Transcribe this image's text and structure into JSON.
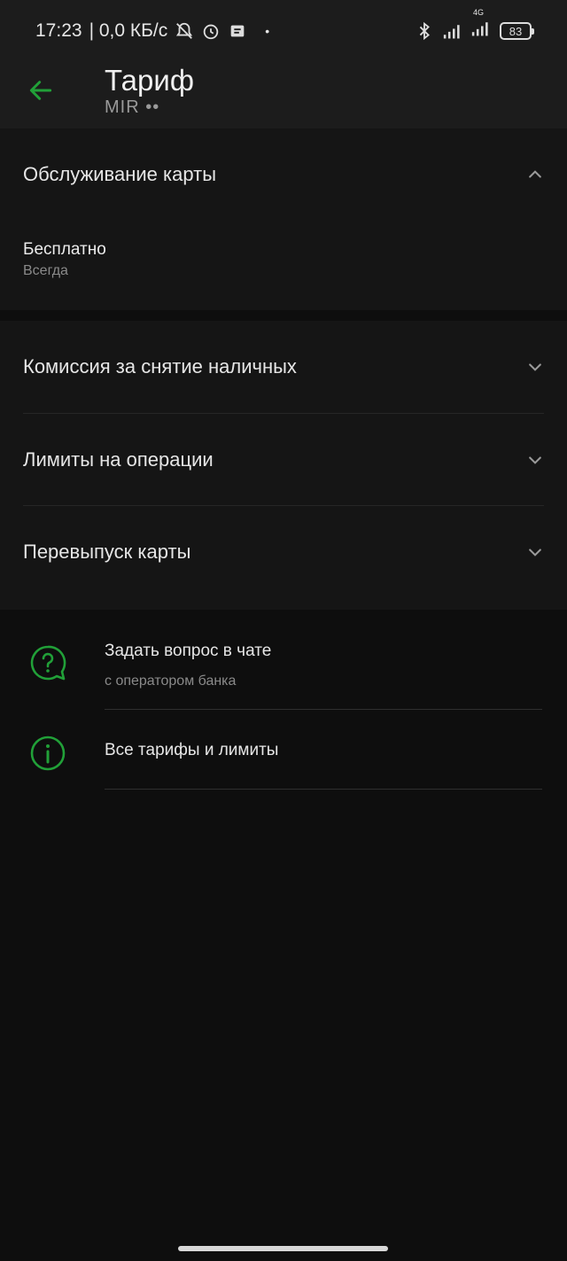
{
  "status_bar": {
    "time": "17:23",
    "speed": "| 0,0 КБ/с",
    "dot": "•",
    "network": "4G",
    "battery": "83",
    "icons": [
      "mute-bell-icon",
      "alarm-icon",
      "message-icon",
      "bluetooth-icon",
      "signal-icon",
      "signal-4g-icon",
      "battery-icon"
    ]
  },
  "header": {
    "title": "Тариф",
    "subtitle": "MIR ••"
  },
  "card_service": {
    "title": "Обслуживание карты",
    "price": "Бесплатно",
    "period": "Всегда"
  },
  "sections": [
    {
      "label": "Комиссия за снятие наличных"
    },
    {
      "label": "Лимиты на операции"
    },
    {
      "label": "Перевыпуск карты"
    }
  ],
  "actions": [
    {
      "title": "Задать вопрос в чате",
      "subtitle": "с оператором банка",
      "icon": "chat-question-icon"
    },
    {
      "title": "Все тарифы и лимиты",
      "icon": "info-icon"
    }
  ],
  "colors": {
    "accent": "#21a038",
    "background": "#0e0e0e",
    "surface": "#151515"
  }
}
